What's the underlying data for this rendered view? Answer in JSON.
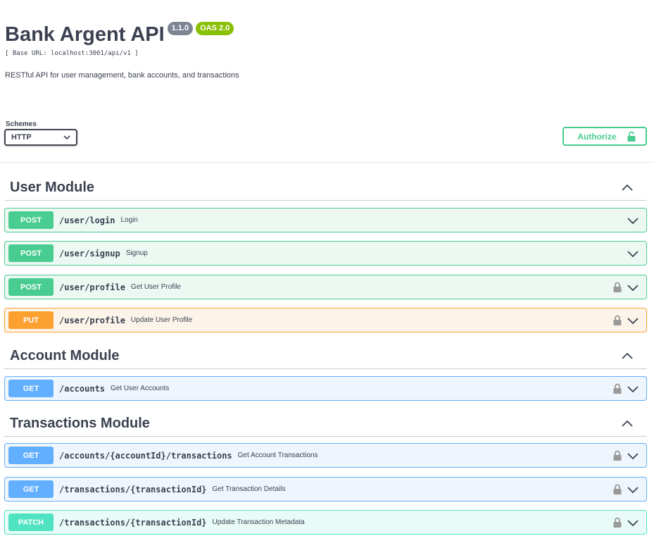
{
  "info": {
    "title": "Bank Argent API",
    "version": "1.1.0",
    "oas": "OAS 2.0",
    "base_url": "[ Base URL: localhost:3001/api/v1 ]",
    "description": "RESTful API for user management, bank accounts, and transactions"
  },
  "schemes": {
    "label": "Schemes",
    "selected": "HTTP"
  },
  "authorize": {
    "label": "Authorize",
    "icon": "unlock-icon"
  },
  "tags": [
    {
      "name": "User Module",
      "operations": [
        {
          "method": "POST",
          "path": "/user/login",
          "summary": "Login",
          "locked": false
        },
        {
          "method": "POST",
          "path": "/user/signup",
          "summary": "Signup",
          "locked": false
        },
        {
          "method": "POST",
          "path": "/user/profile",
          "summary": "Get User Profile",
          "locked": true
        },
        {
          "method": "PUT",
          "path": "/user/profile",
          "summary": "Update User Profile",
          "locked": true
        }
      ]
    },
    {
      "name": "Account Module",
      "operations": [
        {
          "method": "GET",
          "path": "/accounts",
          "summary": "Get User Accounts",
          "locked": true
        }
      ]
    },
    {
      "name": "Transactions Module",
      "operations": [
        {
          "method": "GET",
          "path": "/accounts/{accountId}/transactions",
          "summary": "Get Account Transactions",
          "locked": true
        },
        {
          "method": "GET",
          "path": "/transactions/{transactionId}",
          "summary": "Get Transaction Details",
          "locked": true
        },
        {
          "method": "PATCH",
          "path": "/transactions/{transactionId}",
          "summary": "Update Transaction Metadata",
          "locked": true
        }
      ]
    }
  ],
  "colors": {
    "post": "#49cc90",
    "put": "#fca130",
    "get": "#61affe",
    "patch": "#50e3c2",
    "text": "#3b4151"
  }
}
